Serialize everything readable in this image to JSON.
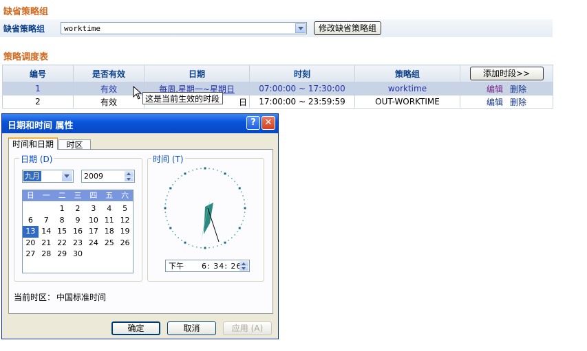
{
  "default_policy": {
    "section_title": "缺省策略组",
    "label": "缺省策略组",
    "selected": "worktime",
    "modify_button": "修改缺省策略组"
  },
  "schedule": {
    "section_title": "策略调度表",
    "headers": [
      "编号",
      "是否有效",
      "日期",
      "时刻",
      "策略组"
    ],
    "add_button": "添加时段>>",
    "rows": [
      {
        "id": "1",
        "valid": "有效",
        "date": "每周,星期一~星期日",
        "time": "07:00:00 ~ 17:30:00",
        "policy": "worktime",
        "edit": "编辑",
        "delete": "删除"
      },
      {
        "id": "2",
        "valid": "有效",
        "date": "日",
        "time": "17:00:00 ~ 23:59:59",
        "policy": "OUT-WORKTIME",
        "edit": "编辑",
        "delete": "删除"
      }
    ],
    "tooltip": "这是当前生效的时段"
  },
  "dialog": {
    "title": "日期和时间 属性",
    "help_button": "?",
    "close_button": "✕",
    "tabs": [
      "时间和日期",
      "时区"
    ],
    "date_group": "日期 (D)",
    "time_group": "时间 (T)",
    "month": "九月",
    "year": "2009",
    "weekdays": [
      "日",
      "一",
      "二",
      "三",
      "四",
      "五",
      "六"
    ],
    "days": [
      "",
      "",
      "1",
      "2",
      "3",
      "4",
      "5",
      "6",
      "7",
      "8",
      "9",
      "10",
      "11",
      "12",
      "13",
      "14",
      "15",
      "16",
      "17",
      "18",
      "19",
      "20",
      "21",
      "22",
      "23",
      "24",
      "25",
      "26",
      "27",
      "28",
      "29",
      "30"
    ],
    "selected_day": "13",
    "ampm": "下午",
    "time_value": "6: 34: 26",
    "timezone_label": "当前时区：",
    "timezone_value": "中国标准时间",
    "ok": "确定",
    "cancel": "取消",
    "apply": "应用 (A)"
  },
  "colors": {
    "section_title": "#d2691e",
    "header_text": "#0a3f8a",
    "highlight_row": "#c8d3e5",
    "titlebar": "#0a55d9",
    "close_button": "#e0452b"
  }
}
